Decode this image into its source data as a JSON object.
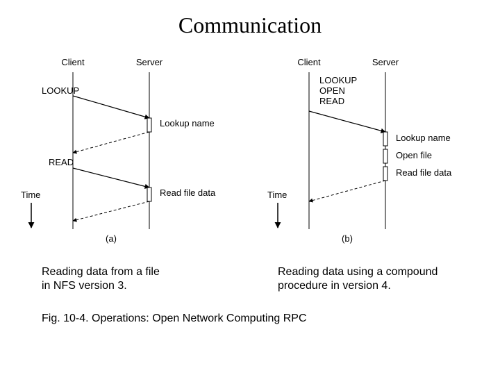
{
  "title": "Communication",
  "diagramA": {
    "client": "Client",
    "server": "Server",
    "lookup": "LOOKUP",
    "lookup_name": "Lookup name",
    "read": "READ",
    "read_file_data": "Read file data",
    "time": "Time",
    "label": "(a)"
  },
  "diagramB": {
    "client": "Client",
    "server": "Server",
    "compound1": "LOOKUP",
    "compound2": "OPEN",
    "compound3": "READ",
    "lookup_name": "Lookup name",
    "open_file": "Open file",
    "read_file_data": "Read file data",
    "time": "Time",
    "label": "(b)"
  },
  "caption_left_l1": "Reading data from a file",
  "caption_left_l2": "in NFS version 3.",
  "caption_right_l1": "Reading data using a compound",
  "caption_right_l2": "procedure in version 4.",
  "fig_caption": "Fig. 10-4. Operations:   Open Network Computing RPC"
}
